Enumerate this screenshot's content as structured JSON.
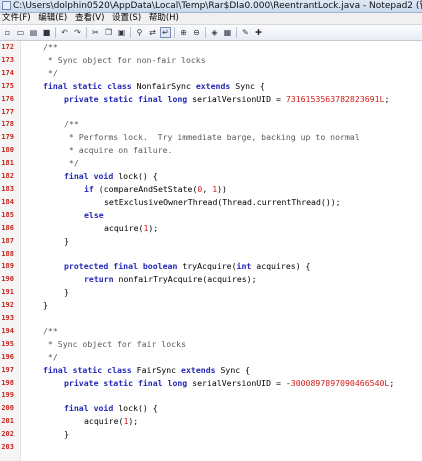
{
  "window": {
    "title": "C:\\Users\\dolphin0520\\AppData\\Local\\Temp\\Rar$DIa0.000\\ReentrantLock.java - Notepad2 (管理员)"
  },
  "menu": [
    {
      "label": "文件(F)"
    },
    {
      "label": "编辑(E)"
    },
    {
      "label": "查看(V)"
    },
    {
      "label": "设置(S)"
    },
    {
      "label": "帮助(H)"
    }
  ],
  "toolbar": {
    "buttons": [
      {
        "name": "new-icon",
        "glyph": "▫"
      },
      {
        "name": "open-icon",
        "glyph": "▭"
      },
      {
        "name": "browse-icon",
        "glyph": "▤"
      },
      {
        "name": "save-icon",
        "glyph": "■"
      },
      {
        "name": "undo-icon",
        "glyph": "↶"
      },
      {
        "name": "redo-icon",
        "glyph": "↷"
      },
      {
        "name": "cut-icon",
        "glyph": "✂"
      },
      {
        "name": "copy-icon",
        "glyph": "❐"
      },
      {
        "name": "paste-icon",
        "glyph": "▣"
      },
      {
        "name": "find-icon",
        "glyph": "⚲"
      },
      {
        "name": "replace-icon",
        "glyph": "⇄"
      },
      {
        "name": "word-wrap-icon",
        "glyph": "↵"
      },
      {
        "name": "zoom-in-icon",
        "glyph": "⊕"
      },
      {
        "name": "zoom-out-icon",
        "glyph": "⊖"
      },
      {
        "name": "scheme-icon",
        "glyph": "◈"
      },
      {
        "name": "customize-icon",
        "glyph": "▦"
      },
      {
        "name": "settings-icon",
        "glyph": "✎"
      },
      {
        "name": "add-favorite-icon",
        "glyph": "✚"
      }
    ]
  },
  "code": [
    {
      "num": "172",
      "indent": 1,
      "tokens": [
        [
          "cm",
          "/**"
        ]
      ]
    },
    {
      "num": "173",
      "indent": 1,
      "tokens": [
        [
          "cm",
          " * Sync object for non-fair locks"
        ]
      ]
    },
    {
      "num": "174",
      "indent": 1,
      "tokens": [
        [
          "cm",
          " */"
        ]
      ]
    },
    {
      "num": "175",
      "indent": 1,
      "tokens": [
        [
          "kw",
          "final static class "
        ],
        [
          "pl",
          "NonfairSync "
        ],
        [
          "kw",
          "extends "
        ],
        [
          "pl",
          "Sync {"
        ]
      ]
    },
    {
      "num": "176",
      "indent": 2,
      "tokens": [
        [
          "kw",
          "private static final long "
        ],
        [
          "pl",
          "serialVersionUID = "
        ],
        [
          "num",
          "7316153563782823691L"
        ],
        [
          "pl",
          ";"
        ]
      ]
    },
    {
      "num": "177",
      "indent": 0,
      "tokens": []
    },
    {
      "num": "178",
      "indent": 2,
      "tokens": [
        [
          "cm",
          "/**"
        ]
      ]
    },
    {
      "num": "179",
      "indent": 2,
      "tokens": [
        [
          "cm",
          " * Performs lock.  Try immediate barge, backing up to normal"
        ]
      ]
    },
    {
      "num": "180",
      "indent": 2,
      "tokens": [
        [
          "cm",
          " * acquire on failure."
        ]
      ]
    },
    {
      "num": "181",
      "indent": 2,
      "tokens": [
        [
          "cm",
          " */"
        ]
      ]
    },
    {
      "num": "182",
      "indent": 2,
      "tokens": [
        [
          "kw",
          "final void "
        ],
        [
          "pl",
          "lock() {"
        ]
      ]
    },
    {
      "num": "183",
      "indent": 3,
      "tokens": [
        [
          "kw",
          "if "
        ],
        [
          "pl",
          "(compareAndSetState("
        ],
        [
          "num",
          "0"
        ],
        [
          "pl",
          ", "
        ],
        [
          "num",
          "1"
        ],
        [
          "pl",
          "))"
        ]
      ]
    },
    {
      "num": "184",
      "indent": 4,
      "tokens": [
        [
          "pl",
          "setExclusiveOwnerThread(Thread.currentThread());"
        ]
      ]
    },
    {
      "num": "185",
      "indent": 3,
      "tokens": [
        [
          "kw",
          "else"
        ]
      ]
    },
    {
      "num": "186",
      "indent": 4,
      "tokens": [
        [
          "pl",
          "acquire("
        ],
        [
          "num",
          "1"
        ],
        [
          "pl",
          ");"
        ]
      ]
    },
    {
      "num": "187",
      "indent": 2,
      "tokens": [
        [
          "pl",
          "}"
        ]
      ]
    },
    {
      "num": "188",
      "indent": 0,
      "tokens": []
    },
    {
      "num": "189",
      "indent": 2,
      "tokens": [
        [
          "kw",
          "protected final boolean "
        ],
        [
          "pl",
          "tryAcquire("
        ],
        [
          "kw",
          "int "
        ],
        [
          "pl",
          "acquires) {"
        ]
      ]
    },
    {
      "num": "190",
      "indent": 3,
      "tokens": [
        [
          "kw",
          "return "
        ],
        [
          "pl",
          "nonfairTryAcquire(acquires);"
        ]
      ]
    },
    {
      "num": "191",
      "indent": 2,
      "tokens": [
        [
          "pl",
          "}"
        ]
      ]
    },
    {
      "num": "192",
      "indent": 1,
      "tokens": [
        [
          "pl",
          "}"
        ]
      ]
    },
    {
      "num": "193",
      "indent": 0,
      "tokens": []
    },
    {
      "num": "194",
      "indent": 1,
      "tokens": [
        [
          "cm",
          "/**"
        ]
      ]
    },
    {
      "num": "195",
      "indent": 1,
      "tokens": [
        [
          "cm",
          " * Sync object for fair locks"
        ]
      ]
    },
    {
      "num": "196",
      "indent": 1,
      "tokens": [
        [
          "cm",
          " */"
        ]
      ]
    },
    {
      "num": "197",
      "indent": 1,
      "tokens": [
        [
          "kw",
          "final static class "
        ],
        [
          "pl",
          "FairSync "
        ],
        [
          "kw",
          "extends "
        ],
        [
          "pl",
          "Sync {"
        ]
      ]
    },
    {
      "num": "198",
      "indent": 2,
      "tokens": [
        [
          "kw",
          "private static final long "
        ],
        [
          "pl",
          "serialVersionUID = -"
        ],
        [
          "num",
          "3000897897090466540L"
        ],
        [
          "pl",
          ";"
        ]
      ]
    },
    {
      "num": "199",
      "indent": 0,
      "tokens": []
    },
    {
      "num": "200",
      "indent": 2,
      "tokens": [
        [
          "kw",
          "final void "
        ],
        [
          "pl",
          "lock() {"
        ]
      ]
    },
    {
      "num": "201",
      "indent": 3,
      "tokens": [
        [
          "pl",
          "acquire("
        ],
        [
          "num",
          "1"
        ],
        [
          "pl",
          ");"
        ]
      ]
    },
    {
      "num": "202",
      "indent": 2,
      "tokens": [
        [
          "pl",
          "}"
        ]
      ]
    },
    {
      "num": "203",
      "indent": 0,
      "tokens": []
    }
  ]
}
